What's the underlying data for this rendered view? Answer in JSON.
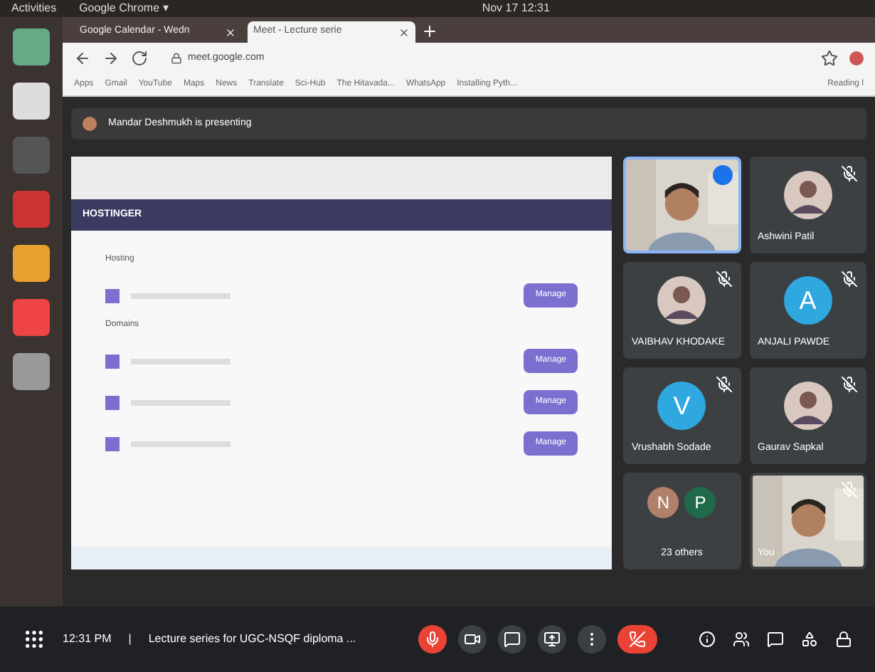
{
  "topbar": {
    "activities": "Activities",
    "app": "Google Chrome ▾",
    "clock": "Nov 17  12:31"
  },
  "browser": {
    "tabs": [
      {
        "title": "Google Calendar - Wedn",
        "selected": false
      },
      {
        "title": "Meet - Lecture serie",
        "selected": true
      }
    ],
    "address": "meet.google.com",
    "bookmarks": [
      "Apps",
      "Gmail",
      "YouTube",
      "Maps",
      "News",
      "Translate",
      "Sci-Hub",
      "The Hitavada...",
      "WhatsApp",
      "Installing Pyth..."
    ],
    "reading_list": "Reading l"
  },
  "presenting": "Mandar Deshmukh is presenting",
  "shared_screen": {
    "brand": "HOSTINGER",
    "sections": [
      {
        "heading": "Hosting",
        "rows": [
          {
            "button": "Manage"
          }
        ]
      },
      {
        "heading": "Domains",
        "rows": [
          {
            "button": "Manage"
          },
          {
            "button": "Manage"
          },
          {
            "button": "Manage"
          }
        ]
      }
    ]
  },
  "tiles": [
    {
      "kind": "video",
      "active": true,
      "muted": false
    },
    {
      "name": "Ashwini Patil",
      "active": false,
      "muted": true
    },
    {
      "name": "VAIBHAV KHODAKE",
      "active": false,
      "muted": true
    },
    {
      "kind": "letter",
      "letter": "A",
      "color": "#2fa8e0",
      "name": "ANJALI PAWDE",
      "active": false,
      "muted": true
    },
    {
      "kind": "letter",
      "letter": "V",
      "color": "#2fa8e0",
      "name": "Vrushabh Sodade",
      "active": false,
      "muted": true
    },
    {
      "name": "Gaurav Sapkal",
      "active": false,
      "muted": true
    },
    {
      "kind": "others",
      "letters": [
        "N",
        "P"
      ],
      "name": "23 others",
      "active": false,
      "muted": false
    },
    {
      "kind": "video",
      "name": "You",
      "active": false,
      "muted": true
    }
  ],
  "bottom": {
    "time": "12:31 PM",
    "separator": "|",
    "meeting": "Lecture series for UGC-NSQF diploma ..."
  }
}
